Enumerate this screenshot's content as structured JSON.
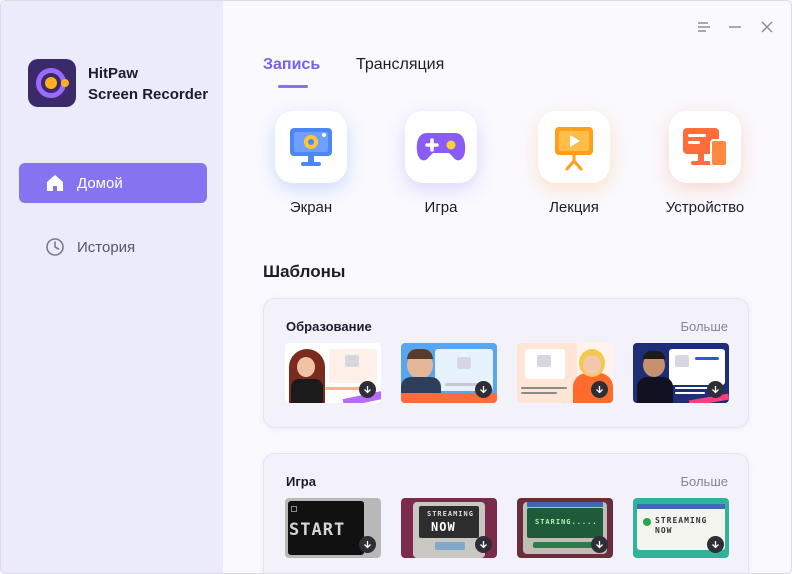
{
  "app": {
    "name_line1": "HitPaw",
    "name_line2": "Screen Recorder"
  },
  "sidebar": {
    "items": [
      {
        "label": "Домой",
        "icon": "home-icon",
        "active": true
      },
      {
        "label": "История",
        "icon": "clock-icon",
        "active": false
      }
    ]
  },
  "window_controls": [
    "menu-icon",
    "minimize-icon",
    "close-icon"
  ],
  "tabs": [
    {
      "label": "Запись",
      "active": true
    },
    {
      "label": "Трансляция",
      "active": false
    }
  ],
  "modes": [
    {
      "label": "Экран",
      "icon": "screen-icon"
    },
    {
      "label": "Игра",
      "icon": "gamepad-icon"
    },
    {
      "label": "Лекция",
      "icon": "lecture-icon"
    },
    {
      "label": "Устройство",
      "icon": "device-icon"
    }
  ],
  "templates": {
    "title": "Шаблоны",
    "sections": [
      {
        "category": "Образование",
        "more": "Больше"
      },
      {
        "category": "Игра",
        "more": "Больше"
      }
    ],
    "game_thumb_text": [
      "START",
      "STREAMING",
      "NOW",
      "STARING.....",
      "STREAMING",
      "NOW"
    ]
  },
  "colors": {
    "accent": "#8574f0",
    "sidebar_bg": "#ecebfb",
    "main_bg": "#faf9fe"
  }
}
